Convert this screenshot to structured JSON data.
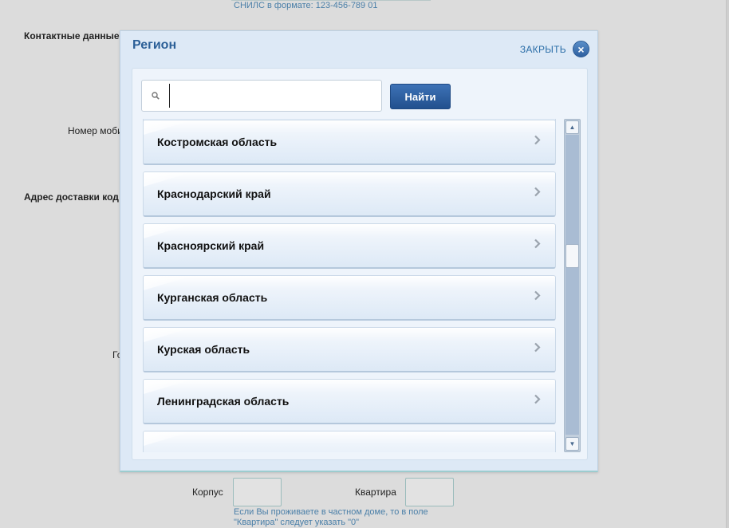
{
  "background": {
    "snils_hint": "СНИЛС в формате: 123-456-789 01",
    "contact_heading": "Контактные данные",
    "mobile_label_partial": "Номер моби",
    "delivery_heading_partial": "Адрес доставки код",
    "city_label_partial": "Го",
    "korpus_label": "Корпус",
    "kvartira_label": "Квартира",
    "house_hint_line1": "Если Вы проживаете в частном доме, то в поле",
    "house_hint_line2": "\"Квартира\" следует указать \"0\""
  },
  "modal": {
    "title": "Регион",
    "close_label": "ЗАКРЫТЬ",
    "search": {
      "value": "",
      "placeholder": ""
    },
    "find_button_label": "Найти",
    "regions": [
      {
        "label": ""
      },
      {
        "label": "Костромская область"
      },
      {
        "label": "Краснодарский край"
      },
      {
        "label": "Красноярский край"
      },
      {
        "label": "Курганская область"
      },
      {
        "label": "Курская область"
      },
      {
        "label": "Ленинградская область"
      },
      {
        "label": ""
      }
    ]
  }
}
